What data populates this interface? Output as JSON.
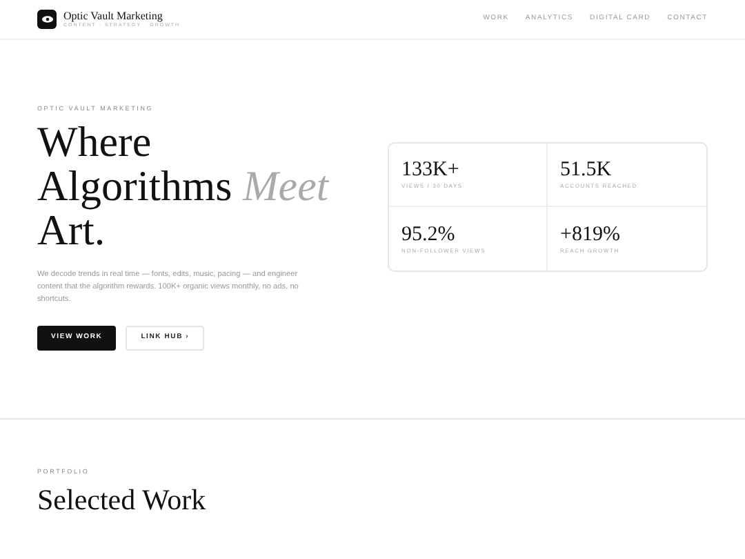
{
  "brand": {
    "name": "Optic Vault Marketing",
    "tagline": "CONTENT · STRATEGY · GROWTH"
  },
  "nav": [
    {
      "label": "WORK"
    },
    {
      "label": "ANALYTICS"
    },
    {
      "label": "DIGITAL CARD"
    },
    {
      "label": "CONTACT"
    }
  ],
  "hero": {
    "eyebrow": "OPTIC VAULT MARKETING",
    "headline": [
      "Where",
      "Algorithms *Meet*",
      "Art."
    ],
    "description": "We decode trends in real time — fonts, edits, music, pacing — and engineer content that the algorithm rewards. 100K+ organic views monthly, no ads, no shortcuts.",
    "buttons": [
      {
        "label": "VIEW WORK",
        "kind": "primary"
      },
      {
        "label": "LINK HUB ›",
        "kind": "secondary"
      }
    ]
  },
  "stats": [
    {
      "value": "133K+",
      "label": "VIEWS / 30 DAYS"
    },
    {
      "value": "51.5K",
      "label": "ACCOUNTS REACHED"
    },
    {
      "value": "95.2%",
      "label": "NON-FOLLOWER VIEWS"
    },
    {
      "value": "+819%",
      "label": "REACH GROWTH"
    }
  ],
  "portfolio": {
    "eyebrow": "PORTFOLIO",
    "title": "Selected Work"
  }
}
